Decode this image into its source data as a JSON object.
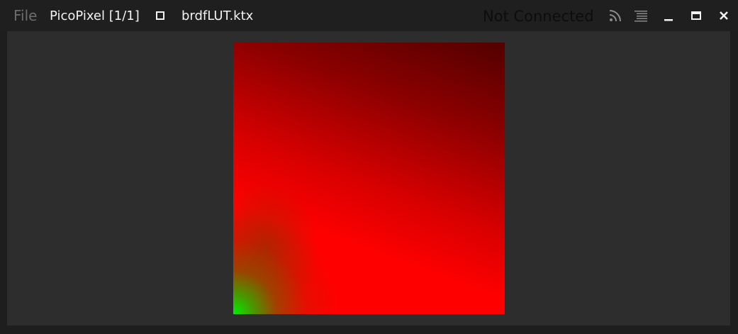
{
  "titlebar": {
    "menu": {
      "file_label": "File"
    },
    "app_title": "PicoPixel [1/1]",
    "file_name": "brdfLUT.ktx",
    "status": "Not Connected",
    "icons": {
      "toggle": "square-icon",
      "connection": "rss-icon",
      "log": "list-icon",
      "minimize": "minimize-icon",
      "maximize": "maximize-icon",
      "close": "close-icon"
    }
  },
  "viewer": {
    "image": "brdfLUT.ktx",
    "colors": {
      "background": "#2d2d2d",
      "lut_red": "#ff0000",
      "lut_green": "#00f000"
    }
  }
}
